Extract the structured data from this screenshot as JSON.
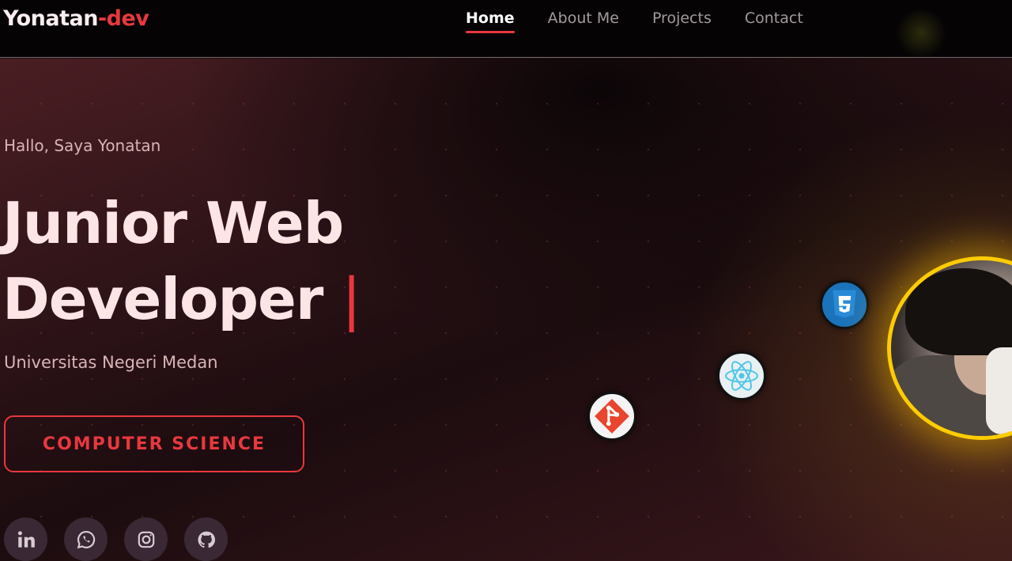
{
  "nav": {
    "brand_main": "Yonatan",
    "brand_accent": "-dev",
    "links": [
      "Home",
      "About Me",
      "Projects",
      "Contact"
    ],
    "active": "Home"
  },
  "hero": {
    "greeting": "Hallo, Saya Yonatan",
    "headline_line1": "Junior Web",
    "headline_line2": "Developer",
    "cursor": "|",
    "subtitle": "Universitas Negeri Medan",
    "cta_label": "COMPUTER SCIENCE"
  },
  "socials": [
    {
      "icon": "linkedin-icon"
    },
    {
      "icon": "whatsapp-icon"
    },
    {
      "icon": "instagram-icon"
    },
    {
      "icon": "github-icon"
    }
  ],
  "tech_icons": [
    "css3-icon",
    "react-icon",
    "git-icon"
  ],
  "colors": {
    "accent": "#e8383e",
    "ring": "#ffcc00",
    "nav_bg": "#050304",
    "text_light": "#fde4e5",
    "text_muted": "#d9b4b6"
  }
}
